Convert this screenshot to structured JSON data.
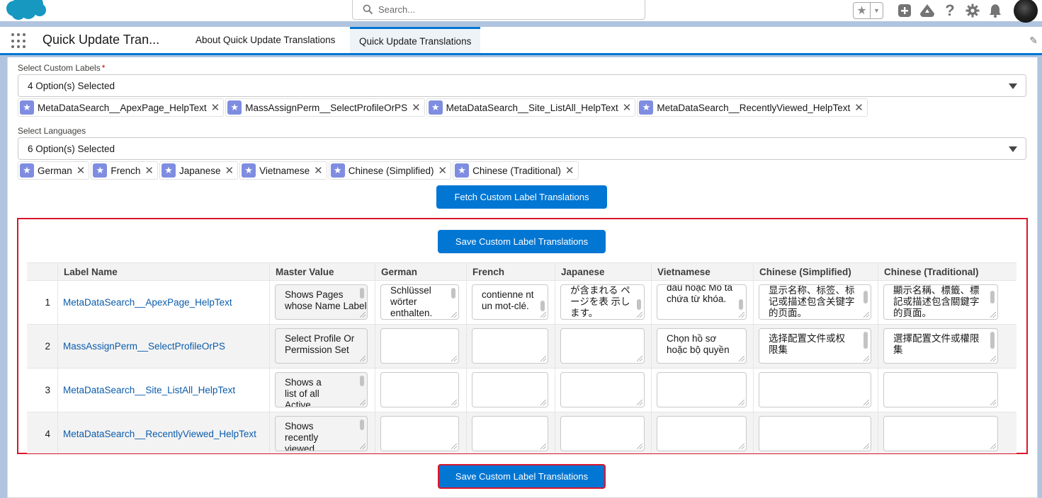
{
  "header": {
    "search_placeholder": "Search..."
  },
  "nav": {
    "app_name": "Quick Update Tran...",
    "tabs": [
      {
        "label": "About Quick Update Translations"
      },
      {
        "label": "Quick Update Translations"
      }
    ]
  },
  "labels_field": {
    "label": "Select Custom Labels",
    "required_marker": "*",
    "value": "4 Option(s) Selected",
    "pills": [
      "MetaDataSearch__ApexPage_HelpText",
      "MassAssignPerm__SelectProfileOrPS",
      "MetaDataSearch__Site_ListAll_HelpText",
      "MetaDataSearch__RecentlyViewed_HelpText"
    ]
  },
  "languages_field": {
    "label": "Select Languages",
    "value": "6 Option(s) Selected",
    "pills": [
      "German",
      "French",
      "Japanese",
      "Vietnamese",
      "Chinese (Simplified)",
      "Chinese (Traditional)"
    ]
  },
  "buttons": {
    "fetch": "Fetch Custom Label Translations",
    "save_top": "Save Custom Label Translations",
    "save_bottom": "Save Custom Label Translations"
  },
  "table": {
    "columns": [
      "Label Name",
      "Master Value",
      "German",
      "French",
      "Japanese",
      "Vietnamese",
      "Chinese (Simplified)",
      "Chinese (Traditional)"
    ],
    "rows": [
      {
        "num": "1",
        "label": "MetaDataSearch__ApexPage_HelpText",
        "master": "Shows Pages whose Name Label",
        "german": "Schlüssel wörter enthalten.",
        "french": "contienne nt un mot-clé.",
        "japanese": "が含まれる ページを表 示します。",
        "vietnamese": "đầu hoặc Mô tả chứa từ khóa.",
        "zh_simplified": "显示名称、标签、标记或描述包含关键字的页面。",
        "zh_traditional": "顯示名稱、標籤、標記或描述包含關鍵字的頁面。"
      },
      {
        "num": "2",
        "label": "MassAssignPerm__SelectProfileOrPS",
        "master": "Select Profile Or Permission Set",
        "german": "",
        "french": "",
        "japanese": "",
        "vietnamese": "Chọn hồ sơ hoặc bộ quyền",
        "zh_simplified": "选择配置文件或权限集",
        "zh_traditional": "選擇配置文件或權限集"
      },
      {
        "num": "3",
        "label": "MetaDataSearch__Site_ListAll_HelpText",
        "master": "Shows a list of all Active, Inactive Sites",
        "german": "",
        "french": "",
        "japanese": "",
        "vietnamese": "",
        "zh_simplified": "",
        "zh_traditional": ""
      },
      {
        "num": "4",
        "label": "MetaDataSearch__RecentlyViewed_HelpText",
        "master": "Shows recently viewed",
        "german": "",
        "french": "",
        "japanese": "",
        "vietnamese": "",
        "zh_simplified": "",
        "zh_traditional": ""
      }
    ]
  }
}
